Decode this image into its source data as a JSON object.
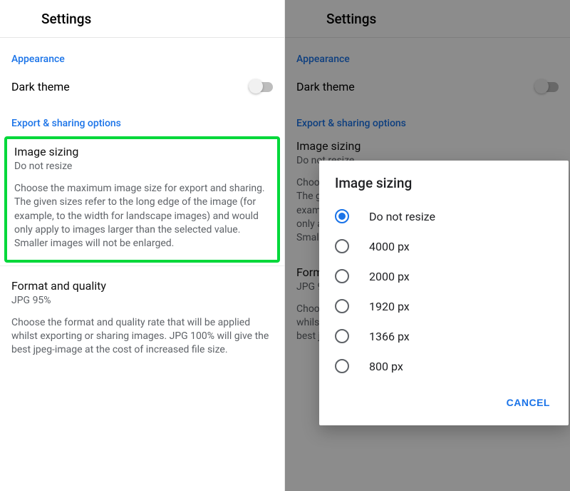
{
  "header": {
    "title": "Settings"
  },
  "sections": {
    "appearance": {
      "label": "Appearance",
      "dark_theme_label": "Dark theme"
    },
    "export": {
      "label": "Export & sharing options",
      "image_sizing": {
        "title": "Image sizing",
        "value": "Do not resize",
        "desc": "Choose the maximum image size for export and sharing. The given sizes refer to the long edge of the image (for example, to the width for landscape images) and would only apply to images larger than the selected value. Smaller images will not be enlarged."
      },
      "format": {
        "title": "Format and quality",
        "value": "JPG 95%",
        "desc": "Choose the format and quality rate that will be applied whilst exporting or sharing images. JPG 100% will give the best jpeg-image at the cost of increased file size."
      }
    }
  },
  "dialog": {
    "title": "Image sizing",
    "options": [
      "Do not resize",
      "4000 px",
      "2000 px",
      "1920 px",
      "1366 px",
      "800 px"
    ],
    "selected_index": 0,
    "cancel_label": "CANCEL"
  }
}
